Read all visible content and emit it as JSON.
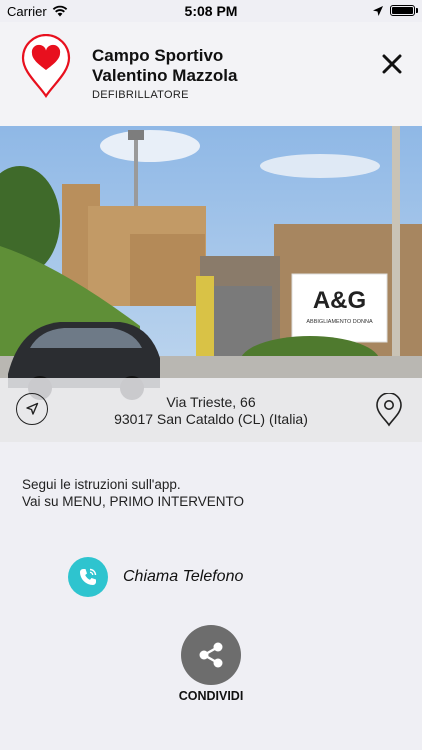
{
  "status_bar": {
    "carrier": "Carrier",
    "time": "5:08 PM"
  },
  "header": {
    "title_line1": "Campo Sportivo",
    "title_line2": "Valentino Mazzola",
    "subtitle": "DEFIBRILLATORE",
    "logo_icon": "heart-map-pin-icon",
    "close_icon": "close-icon",
    "brand_color": "#e8101e"
  },
  "photo": {
    "sign_logo": "A&G",
    "sign_subtitle": "ABBIGLIAMENTO DONNA"
  },
  "address": {
    "line1": "Via Trieste, 66",
    "line2": "93017 San Cataldo (CL) (Italia)",
    "nav_icon": "navigation-arrow-icon",
    "pin_icon": "map-pin-icon"
  },
  "instructions": {
    "line1": "Segui le istruzioni sull'app.",
    "line2": "Vai su MENU, PRIMO INTERVENTO"
  },
  "call": {
    "label": "Chiama Telefono",
    "icon": "phone-icon",
    "color": "#2ec4cf"
  },
  "share": {
    "label": "CONDIVIDI",
    "icon": "share-icon",
    "color": "#6d6d6d"
  }
}
